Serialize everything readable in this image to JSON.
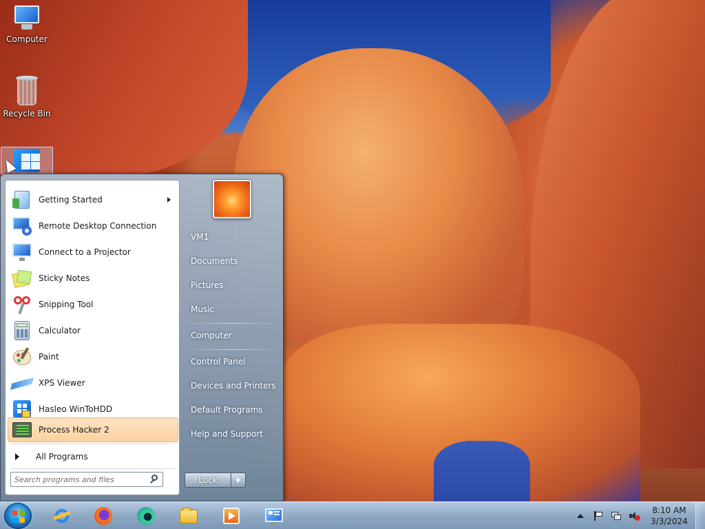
{
  "desktop": {
    "icons": [
      {
        "label": "Computer"
      },
      {
        "label": "Recycle Bin"
      },
      {
        "label": ""
      }
    ]
  },
  "start_menu": {
    "programs": [
      {
        "label": "Getting Started",
        "icon": "getting-started-icon",
        "has_submenu": true
      },
      {
        "label": "Remote Desktop Connection",
        "icon": "remote-desktop-icon"
      },
      {
        "label": "Connect to a Projector",
        "icon": "projector-icon"
      },
      {
        "label": "Sticky Notes",
        "icon": "sticky-notes-icon"
      },
      {
        "label": "Snipping Tool",
        "icon": "snipping-tool-icon"
      },
      {
        "label": "Calculator",
        "icon": "calculator-icon"
      },
      {
        "label": "Paint",
        "icon": "paint-icon"
      },
      {
        "label": "XPS Viewer",
        "icon": "xps-viewer-icon"
      },
      {
        "label": "Hasleo WinToHDD",
        "icon": "wintohdd-icon"
      },
      {
        "label": "Process Hacker 2",
        "icon": "process-hacker-icon",
        "highlighted": true
      }
    ],
    "all_programs_label": "All Programs",
    "search_placeholder": "Search programs and files",
    "right_items": [
      {
        "label": "VM1"
      },
      {
        "label": "Documents"
      },
      {
        "label": "Pictures"
      },
      {
        "label": "Music"
      },
      {
        "label": "Computer"
      },
      {
        "label": "Control Panel"
      },
      {
        "label": "Devices and Printers"
      },
      {
        "label": "Default Programs"
      },
      {
        "label": "Help and Support"
      }
    ],
    "lock_label": "Lock"
  },
  "taskbar": {
    "pinned": [
      "internet-explorer-icon",
      "firefox-icon",
      "edge-icon",
      "file-explorer-icon",
      "media-player-icon",
      "system-tool-icon"
    ],
    "clock": {
      "time": "8:10 AM",
      "date": "3/3/2024"
    }
  },
  "colors": {
    "highlight": "#fbd2a0",
    "taskbar": "#9bb2c8",
    "sky": "#2a5ab8"
  }
}
